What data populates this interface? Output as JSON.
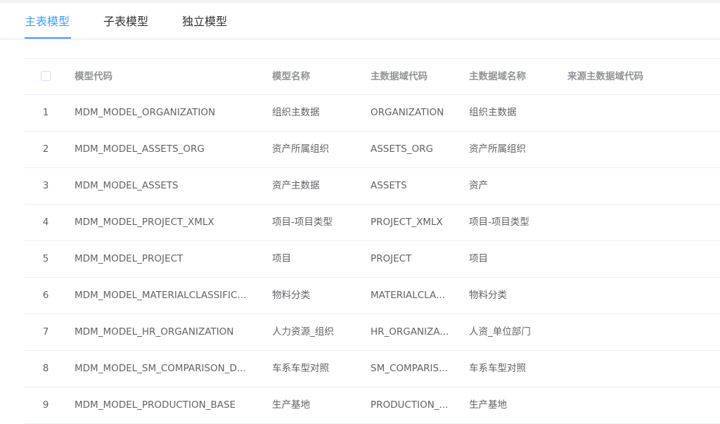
{
  "tabs": [
    {
      "label": "主表模型",
      "active": true
    },
    {
      "label": "子表模型",
      "active": false
    },
    {
      "label": "独立模型",
      "active": false
    }
  ],
  "table": {
    "columns": [
      "模型代码",
      "模型名称",
      "主数据域代码",
      "主数据域名称",
      "来源主数据域代码"
    ],
    "rows": [
      [
        "1",
        "MDM_MODEL_ORGANIZATION",
        "组织主数据",
        "ORGANIZATION",
        "组织主数据"
      ],
      [
        "2",
        "MDM_MODEL_ASSETS_ORG",
        "资产所属组织",
        "ASSETS_ORG",
        "资产所属组织"
      ],
      [
        "3",
        "MDM_MODEL_ASSETS",
        "资产主数据",
        "ASSETS",
        "资产"
      ],
      [
        "4",
        "MDM_MODEL_PROJECT_XMLX",
        "项目-项目类型",
        "PROJECT_XMLX",
        "项目-项目类型"
      ],
      [
        "5",
        "MDM_MODEL_PROJECT",
        "项目",
        "PROJECT",
        "项目"
      ],
      [
        "6",
        "MDM_MODEL_MATERIALCLASSIFIC...",
        "物料分类",
        "MATERIALCLA...",
        "物料分类"
      ],
      [
        "7",
        "MDM_MODEL_HR_ORGANIZATION",
        "人力资源_组织",
        "HR_ORGANIZA...",
        "人资_单位部门"
      ],
      [
        "8",
        "MDM_MODEL_SM_COMPARISON_D...",
        "车系车型对照",
        "SM_COMPARIS...",
        "车系车型对照"
      ],
      [
        "9",
        "MDM_MODEL_PRODUCTION_BASE",
        "生产基地",
        "PRODUCTION_...",
        "生产基地"
      ]
    ]
  },
  "colors": {
    "accent": "#409eff",
    "text": "#606266",
    "header": "#909399",
    "border": "#ebeef5"
  }
}
